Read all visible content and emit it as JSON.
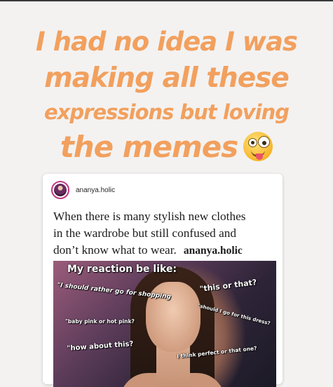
{
  "story": {
    "caption_lines": [
      "I had no idea I was",
      "making all these",
      "expressions but loving",
      "the memes"
    ],
    "emoji": "zany-face-icon"
  },
  "post": {
    "username": "ananya.holic",
    "text_lines": [
      "When there is many stylish new clothes",
      "in the wardrobe but still confused and",
      "don’t know what to wear."
    ],
    "watermark": "ananya.holic",
    "meme": {
      "title": "My reaction be like:",
      "captions": [
        "\"I should rather go for shopping",
        "\"this or that?",
        "\"should I go for this dress?",
        "\"baby pink or hot pink?",
        "\"how about this?",
        "I think perfect or that one?"
      ]
    }
  }
}
